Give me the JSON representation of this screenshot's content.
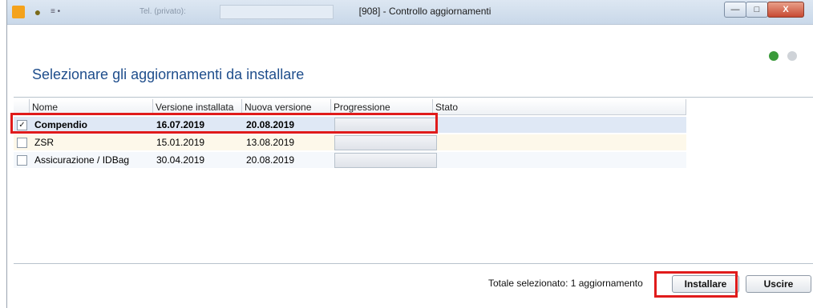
{
  "window": {
    "title": "[908] - Controllo aggiornamenti",
    "quick_access": {
      "dropdown_label": "≡ •",
      "faded_label": "Tel. (privato):"
    },
    "controls": {
      "minimize": "—",
      "maximize": "□",
      "close": "X"
    }
  },
  "heading": "Selezionare gli aggiornamenti da installare",
  "grid": {
    "columns": [
      "Nome",
      "Versione installata",
      "Nuova versione",
      "Progressione",
      "Stato"
    ],
    "rows": [
      {
        "checked": "✓",
        "nome": "Compendio",
        "versione_installata": "16.07.2019",
        "nuova_versione": "20.08.2019",
        "progressione": "",
        "stato": ""
      },
      {
        "checked": "",
        "nome": "ZSR",
        "versione_installata": "15.01.2019",
        "nuova_versione": "13.08.2019",
        "progressione": "",
        "stato": ""
      },
      {
        "checked": "",
        "nome": "Assicurazione / IDBag",
        "versione_installata": "30.04.2019",
        "nuova_versione": "20.08.2019",
        "progressione": "",
        "stato": ""
      }
    ]
  },
  "footer": {
    "summary": "Totale selezionato: 1 aggiornamento",
    "install_label": "Installare",
    "exit_label": "Uscire"
  },
  "colors": {
    "highlight": "#e01b1b",
    "heading": "#1f4e8c"
  }
}
